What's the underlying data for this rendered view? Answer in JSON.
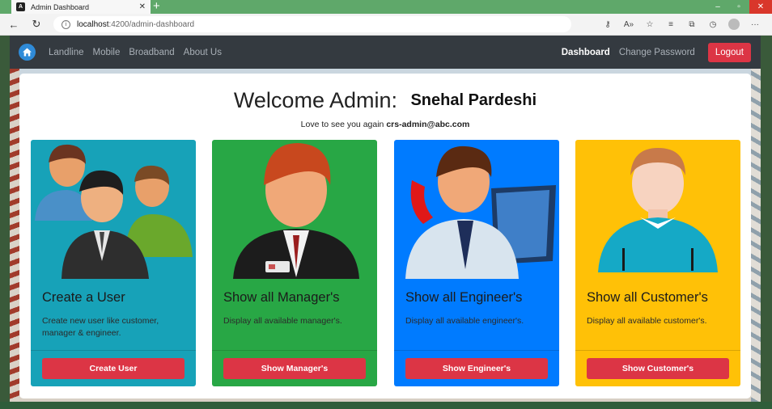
{
  "browser": {
    "tab_title": "Admin Dashboard",
    "url_host": "localhost",
    "url_path": ":4200/admin-dashboard"
  },
  "navbar": {
    "links": [
      "Landline",
      "Mobile",
      "Broadband",
      "About Us"
    ],
    "dashboard": "Dashboard",
    "change_password": "Change Password",
    "logout": "Logout"
  },
  "welcome": {
    "heading": "Welcome Admin:",
    "name": "Snehal Pardeshi",
    "subtitle_prefix": "Love to see you again",
    "email": "crs-admin@abc.com"
  },
  "cards": [
    {
      "title": "Create a User",
      "description": "Create new user like customer, manager & engineer.",
      "button": "Create User",
      "color": "#17a2b8"
    },
    {
      "title": "Show all Manager's",
      "description": "Display all available manager's.",
      "button": "Show Manager's",
      "color": "#28a745"
    },
    {
      "title": "Show all Engineer's",
      "description": "Display all available engineer's.",
      "button": "Show Engineer's",
      "color": "#007bff"
    },
    {
      "title": "Show all Customer's",
      "description": "Display all available customer's.",
      "button": "Show Customer's",
      "color": "#ffc107"
    }
  ]
}
